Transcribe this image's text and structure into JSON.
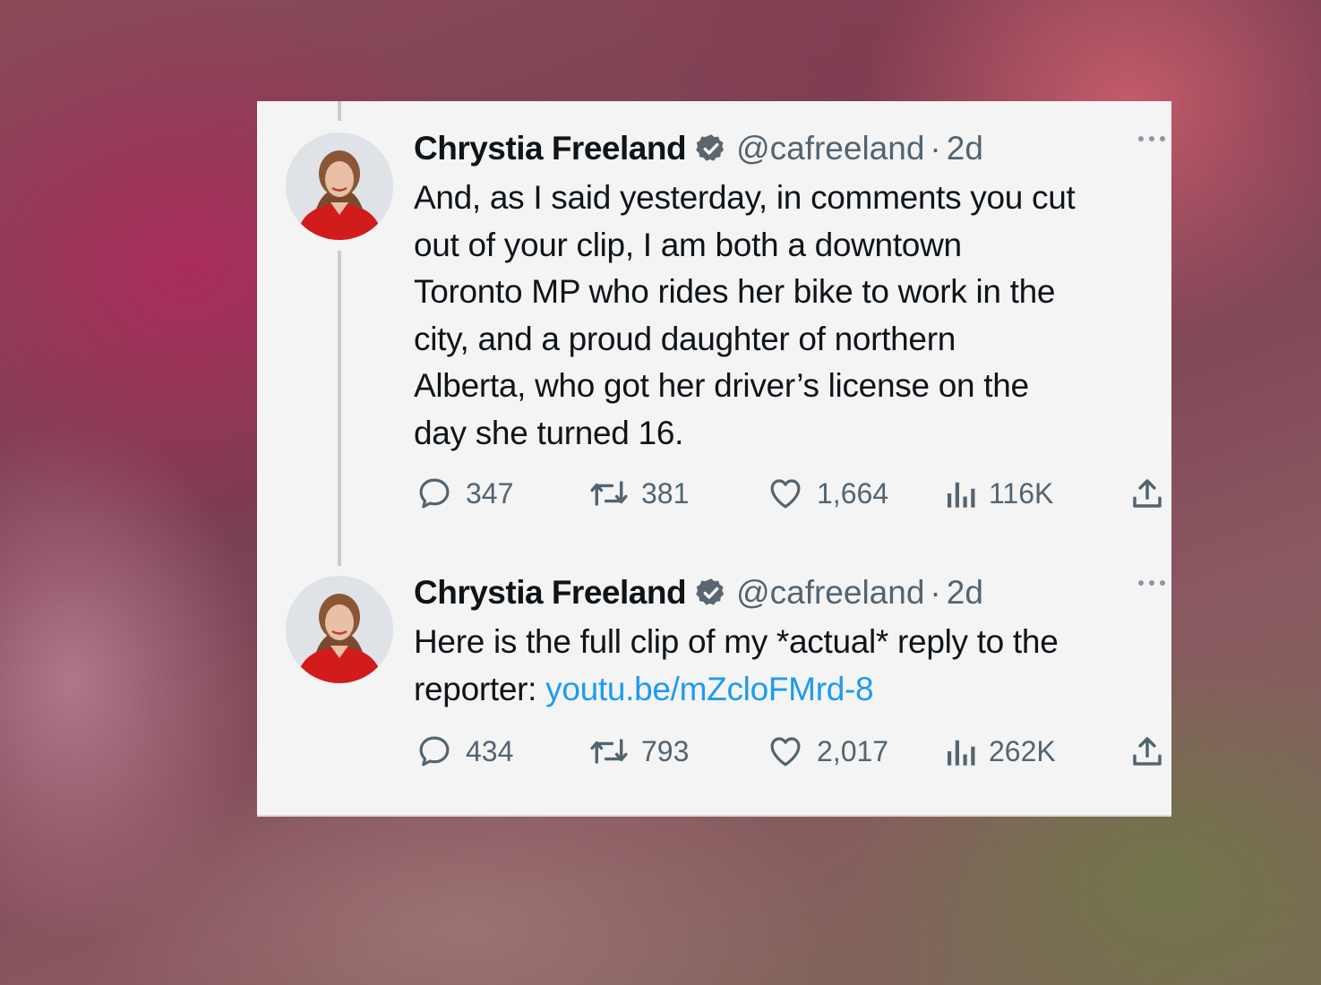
{
  "colors": {
    "text": "#0f1419",
    "secondary": "#536471",
    "link": "#1d9bf0",
    "verified": "#5b6670",
    "card_bg": "#f4f4f4"
  },
  "tweets": [
    {
      "name": "Chrystia Freeland",
      "handle": "@cafreeland",
      "separator": "·",
      "time": "2d",
      "text_lines": [
        "And, as I said yesterday, in comments you cut",
        "out of your clip, I am both a downtown",
        "Toronto MP who rides her bike to work in the",
        "city, and a proud daughter of northern",
        "Alberta, who got her driver’s license on the",
        "day she turned 16."
      ],
      "replies": "347",
      "reposts": "381",
      "likes": "1,664",
      "views": "116K",
      "icons": [
        "verified-badge-icon",
        "more-icon",
        "reply-icon",
        "repost-icon",
        "like-icon",
        "views-icon",
        "share-icon"
      ]
    },
    {
      "name": "Chrystia Freeland",
      "handle": "@cafreeland",
      "separator": "·",
      "time": "2d",
      "text_line_1": "Here is the full clip of my *actual* reply to the",
      "text_line_2_prefix": "reporter: ",
      "link": "youtu.be/mZcloFMrd-8",
      "replies": "434",
      "reposts": "793",
      "likes": "2,017",
      "views": "262K",
      "icons": [
        "verified-badge-icon",
        "more-icon",
        "reply-icon",
        "repost-icon",
        "like-icon",
        "views-icon",
        "share-icon"
      ]
    }
  ]
}
